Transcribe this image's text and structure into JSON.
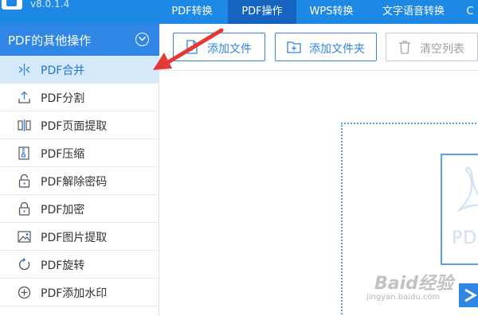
{
  "app": {
    "version": "v8.0.1.4"
  },
  "nav": {
    "tabs": [
      {
        "label": "PDF转换",
        "active": false
      },
      {
        "label": "PDF操作",
        "active": true
      },
      {
        "label": "WPS转换",
        "active": false
      },
      {
        "label": "文字语音转换",
        "active": false
      },
      {
        "label": "C",
        "active": false
      }
    ]
  },
  "sidebar": {
    "title": "PDF的其他操作",
    "items": [
      {
        "label": "PDF合并",
        "icon": "merge-icon",
        "active": true
      },
      {
        "label": "PDF分割",
        "icon": "upload-icon",
        "active": false
      },
      {
        "label": "PDF页面提取",
        "icon": "page-extract-icon",
        "active": false
      },
      {
        "label": "PDF压缩",
        "icon": "compress-icon",
        "active": false
      },
      {
        "label": "PDF解除密码",
        "icon": "unlock-icon",
        "active": false
      },
      {
        "label": "PDF加密",
        "icon": "lock-icon",
        "active": false
      },
      {
        "label": "PDF图片提取",
        "icon": "image-icon",
        "active": false
      },
      {
        "label": "PDF旋转",
        "icon": "rotate-icon",
        "active": false
      },
      {
        "label": "PDF添加水印",
        "icon": "add-circle-icon",
        "active": false
      }
    ]
  },
  "toolbar": {
    "add_file": "添加文件",
    "add_folder": "添加文件夹",
    "clear_list": "清空列表"
  },
  "dropzone": {
    "doc_text": "PDF"
  },
  "watermark": {
    "brand": "Baid经验",
    "url": "jingyan.baidu.com"
  },
  "colors": {
    "primary": "#1e88e5",
    "active_tab": "#1565c0",
    "sidebar_header": "#2f86e4",
    "active_item_bg": "#d6e9fb",
    "annotation_arrow": "#e53935"
  }
}
